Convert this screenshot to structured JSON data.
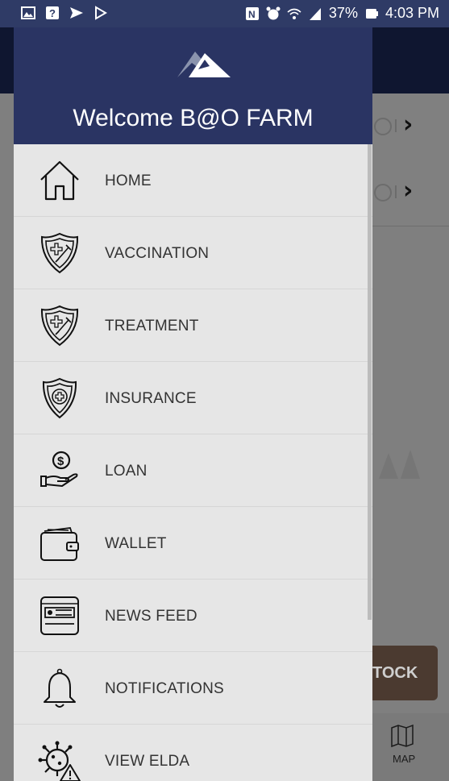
{
  "status_bar": {
    "battery": "37%",
    "time": "4:03 PM",
    "left_icons": [
      "gallery-icon",
      "help-icon",
      "send-icon",
      "play-icon"
    ],
    "right_icons": [
      "nfc-icon",
      "alarm-icon",
      "wifi-icon",
      "signal-icon",
      "battery-icon"
    ]
  },
  "drawer": {
    "welcome": "Welcome B@O FARM",
    "items": [
      {
        "label": "HOME",
        "icon": "home-icon"
      },
      {
        "label": "VACCINATION",
        "icon": "vaccination-shield-icon"
      },
      {
        "label": "TREATMENT",
        "icon": "treatment-shield-icon"
      },
      {
        "label": "INSURANCE",
        "icon": "insurance-shield-icon"
      },
      {
        "label": "LOAN",
        "icon": "loan-hand-coin-icon"
      },
      {
        "label": "WALLET",
        "icon": "wallet-icon"
      },
      {
        "label": "NEWS FEED",
        "icon": "news-feed-icon"
      },
      {
        "label": "NOTIFICATIONS",
        "icon": "bell-icon"
      },
      {
        "label": "VIEW ELDA",
        "icon": "virus-warning-icon"
      }
    ]
  },
  "background": {
    "stock_button": "TOCK",
    "map_label": "MAP"
  },
  "colors": {
    "header": "#2a3463",
    "drawer_bg": "#e6e6e6",
    "status_bar": "#2f3b66"
  }
}
